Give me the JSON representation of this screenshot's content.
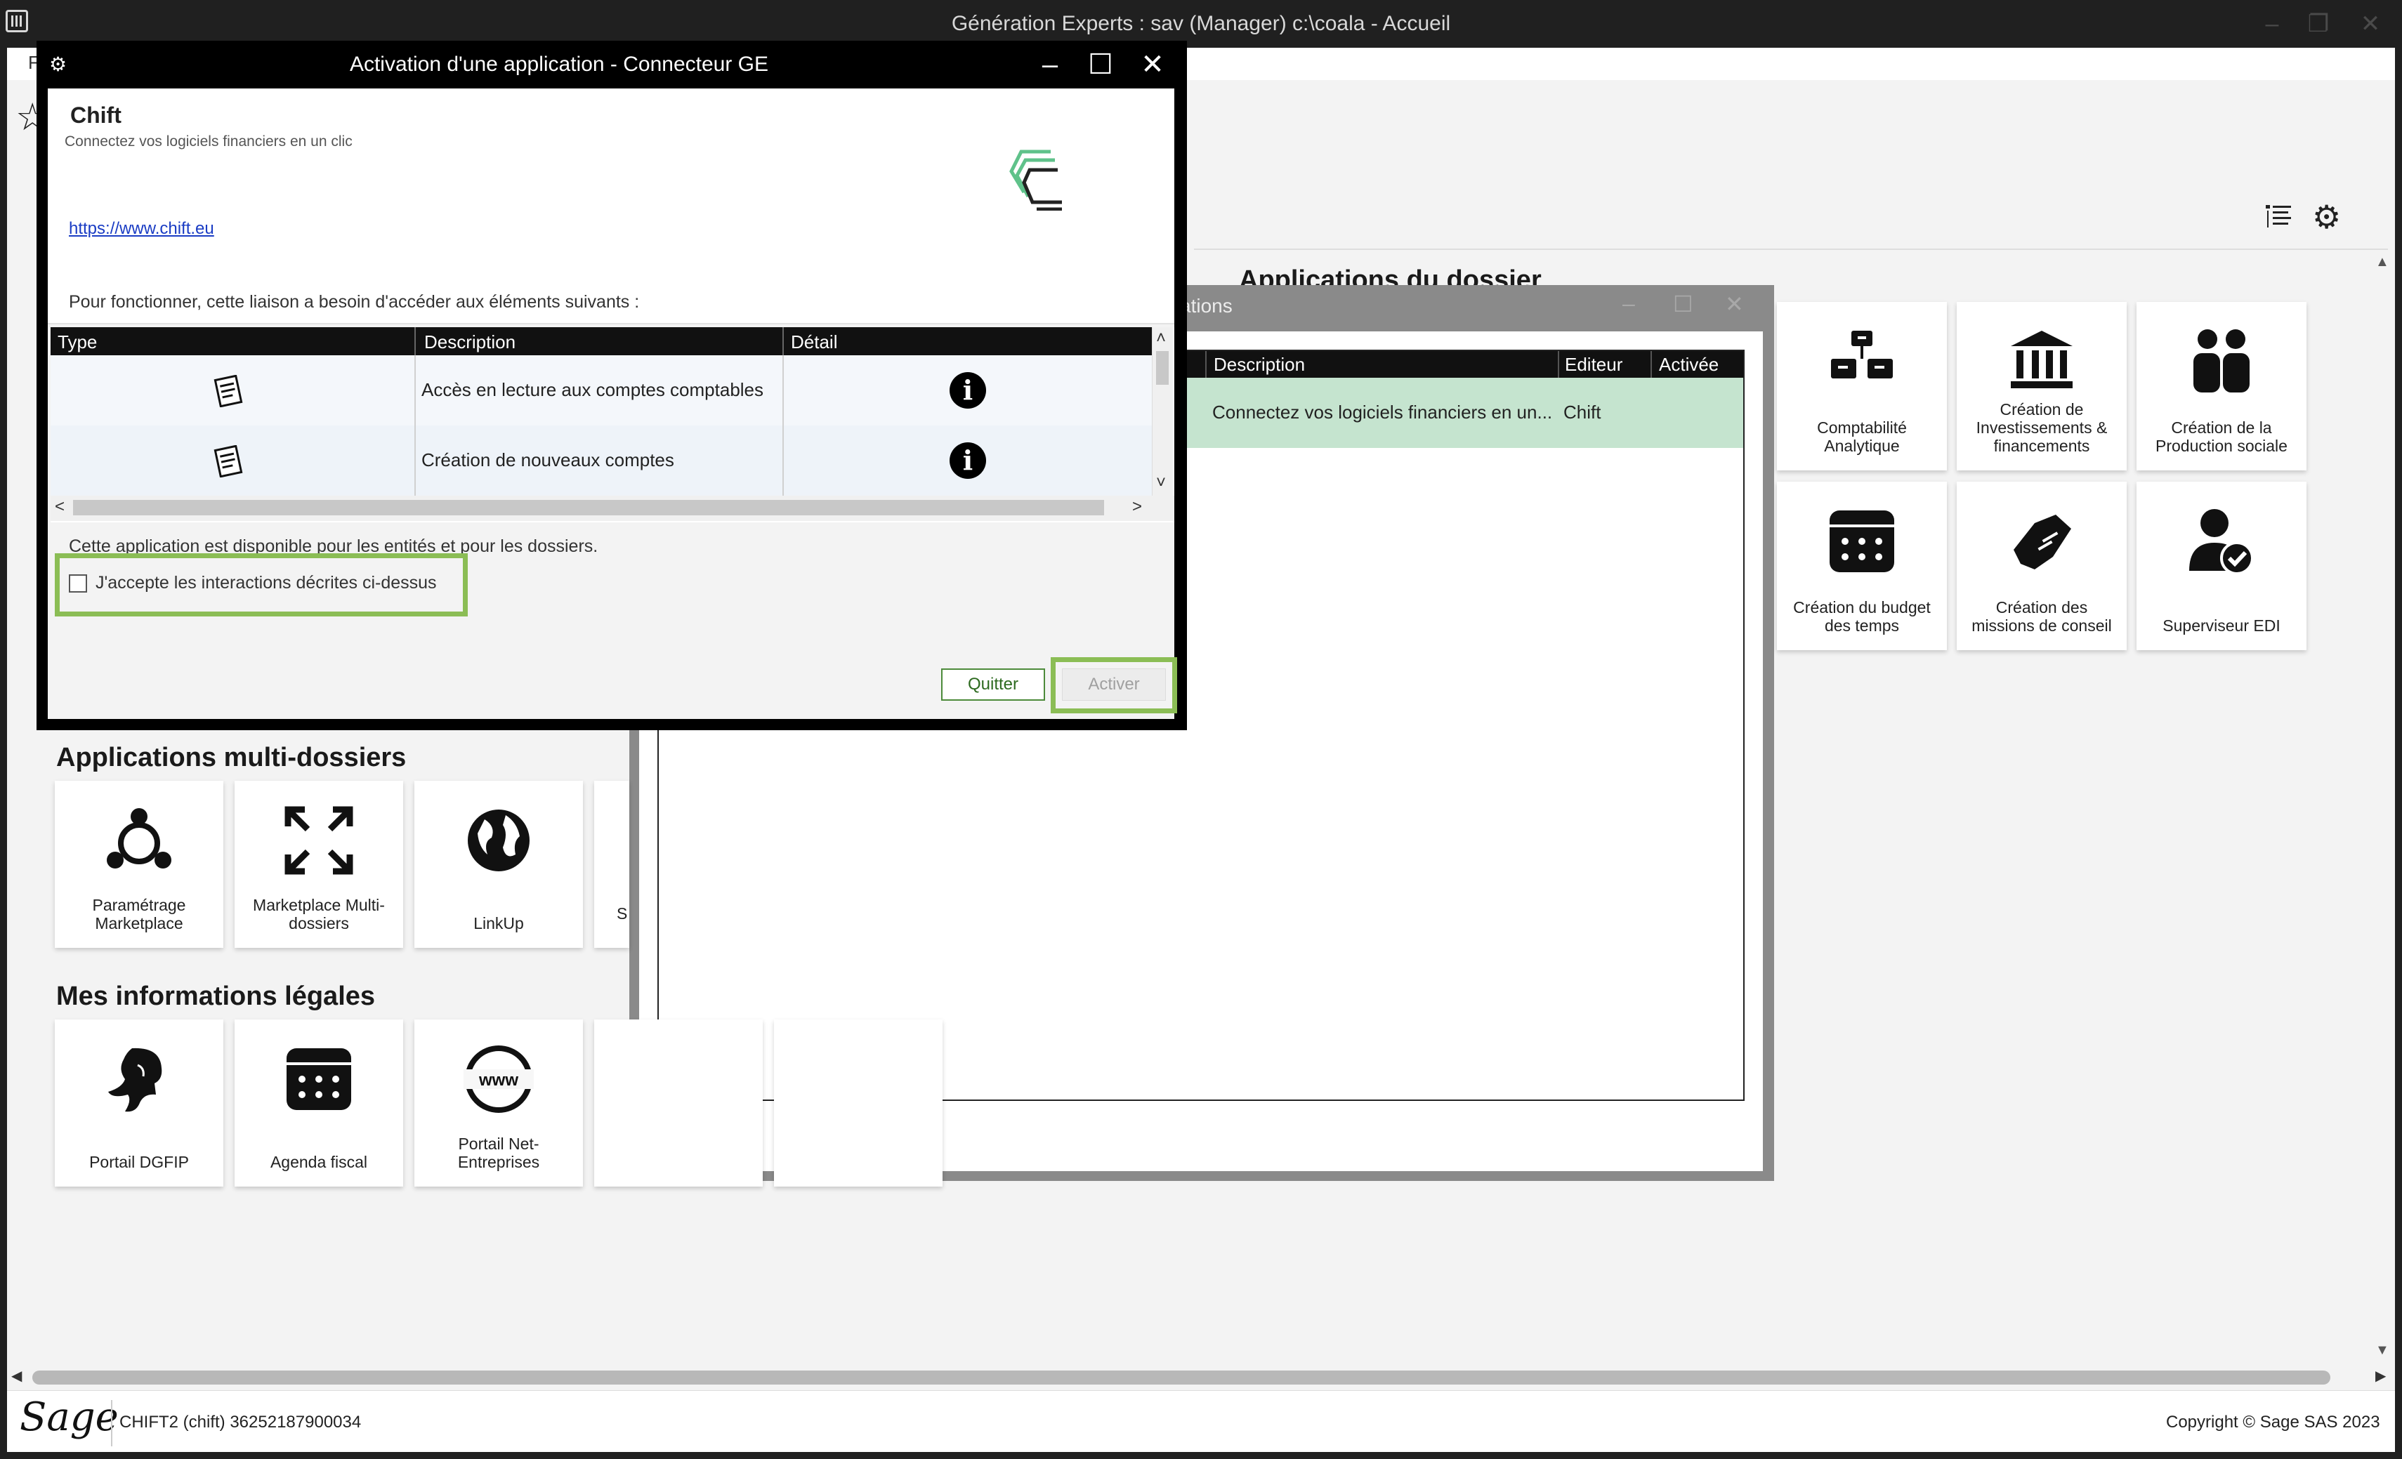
{
  "window": {
    "title": "Génération Experts : sav (Manager) c:\\coala - Accueil",
    "menu_first_letter": "F"
  },
  "sections": {
    "dossier": "Applications du dossier",
    "multi": "Applications multi-dossiers",
    "legal": "Mes informations légales"
  },
  "dossier_tiles": [
    {
      "label": "Comptabilité Analytique",
      "icon": "hierarchy-boxes-icon"
    },
    {
      "label": "Création de Investissements & financements",
      "icon": "bank-icon"
    },
    {
      "label": "Création de la Production sociale",
      "icon": "people-icon"
    },
    {
      "label": "Création du budget des temps",
      "icon": "calendar-icon"
    },
    {
      "label": "Création des missions de conseil",
      "icon": "handshake-icon"
    },
    {
      "label": "Superviseur EDI",
      "icon": "user-check-icon"
    }
  ],
  "multi_tiles": [
    {
      "label": "Paramétrage Marketplace",
      "icon": "network-icon"
    },
    {
      "label": "Marketplace Multi-dossiers",
      "icon": "expand-arrows-icon"
    },
    {
      "label": "LinkUp",
      "icon": "globe-icon"
    },
    {
      "label": "S",
      "icon": ""
    }
  ],
  "legal_tiles": [
    {
      "label": "Portail DGFIP",
      "icon": "marianne-icon"
    },
    {
      "label": "Agenda fiscal",
      "icon": "calendar-icon"
    },
    {
      "label": "Portail Net-Entreprises",
      "icon": "www-globe-icon"
    }
  ],
  "bg_window": {
    "title_fragment": "ations",
    "columns": [
      "Description",
      "Editeur",
      "Activée"
    ],
    "row": {
      "description": "Connectez vos logiciels financiers en un...",
      "editor": "Chift",
      "activated": ""
    }
  },
  "modal": {
    "title": "Activation d'une application - Connecteur GE",
    "app_name": "Chift",
    "tagline": "Connectez vos logiciels financiers en un clic",
    "link": "https://www.chift.eu",
    "needs_text": "Pour fonctionner, cette liaison a besoin d'accéder aux éléments suivants :",
    "columns": [
      "Type",
      "Description",
      "Détail"
    ],
    "rows": [
      {
        "description": "Accès en lecture aux comptes comptables",
        "icon": "document-icon"
      },
      {
        "description": "Création de nouveaux comptes",
        "icon": "document-icon"
      }
    ],
    "availability": "Cette application est disponible pour les entités et pour les dossiers.",
    "accept_label": "J'accepte les interactions décrites ci-dessus",
    "quit_label": "Quitter",
    "activate_label": "Activer"
  },
  "footer": {
    "logo": "Sage",
    "entity": "CHIFT2 (chift) 36252187900034",
    "copyright": "Copyright © Sage SAS 2023"
  },
  "colors": {
    "accent_green": "#8bbd55",
    "row_highlight": "#c5e4cf",
    "chift_green": "#5fc28a"
  }
}
